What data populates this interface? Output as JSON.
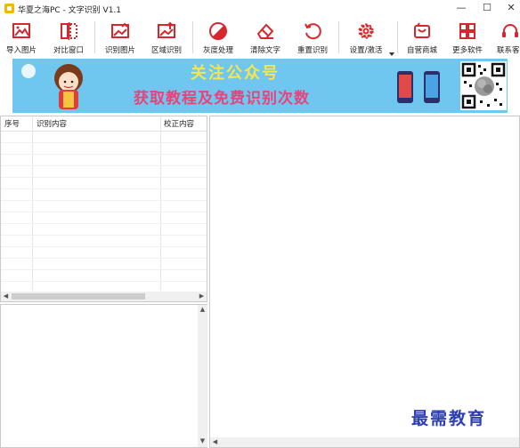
{
  "window": {
    "title": "华夏之海PC - 文字识别 V1.1",
    "minimize_glyph": "—",
    "maximize_glyph": "☐",
    "close_glyph": "✕"
  },
  "toolbar": {
    "import_label": "导入图片",
    "compare_label": "对比窗口",
    "recognize_label": "识别图片",
    "region_label": "区域识别",
    "grayscale_label": "灰度处理",
    "clear_label": "清除文字",
    "reset_label": "重置识别",
    "settings_label": "设置/激活",
    "store_label": "自营商城",
    "more_label": "更多软件",
    "contact_label": "联系客"
  },
  "banner": {
    "line1": "关注公众号",
    "line2": "获取教程及免费识别次数"
  },
  "table": {
    "col_index": "序号",
    "col_content": "识别内容",
    "col_corrected": "校正内容"
  },
  "watermark": "最需教育",
  "colors": {
    "banner_bg": "#6fc7ef",
    "banner_title": "#f7e64a",
    "banner_sub": "#e8437a",
    "icon_red": "#d6282c",
    "watermark": "#2d3fb0"
  },
  "icons": [
    "app-icon",
    "image-import-icon",
    "compare-window-icon",
    "recognize-image-icon",
    "region-recognize-icon",
    "grayscale-icon",
    "eraser-icon",
    "reset-icon",
    "gear-icon",
    "store-icon",
    "apps-grid-icon",
    "headset-icon"
  ]
}
